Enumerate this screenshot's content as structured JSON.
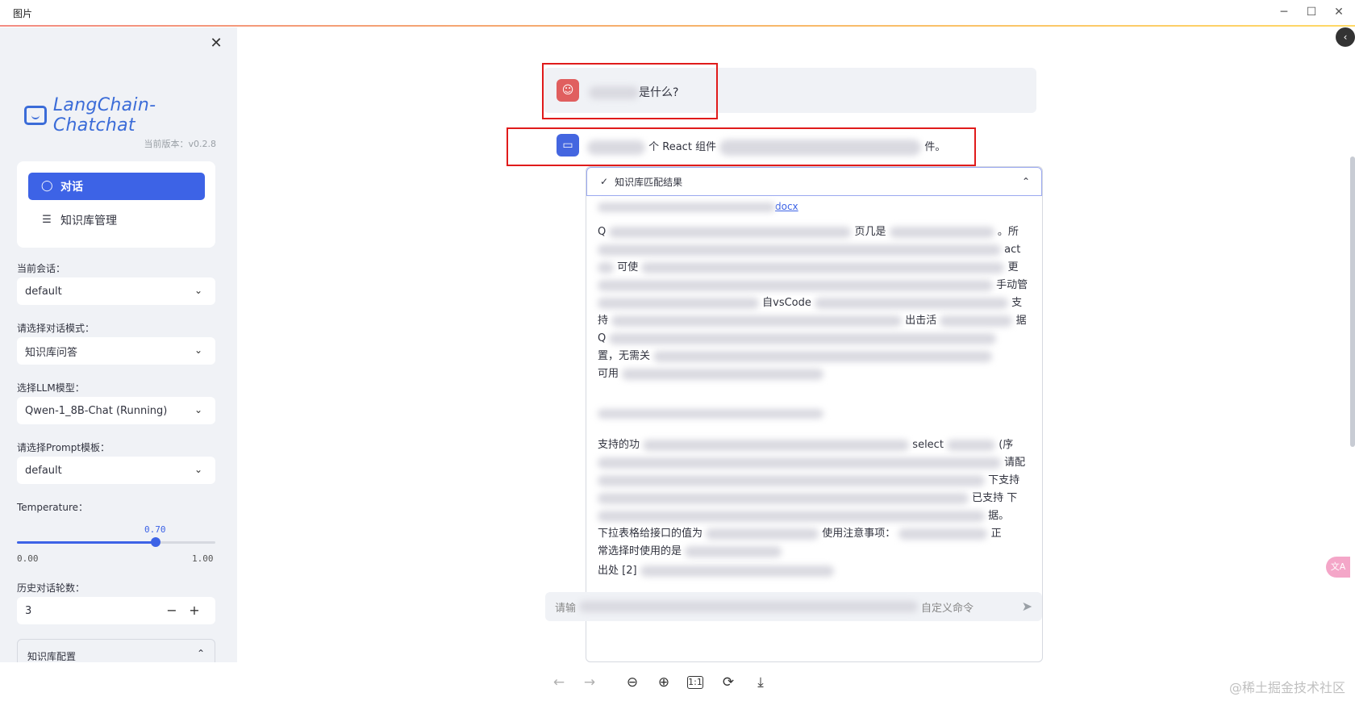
{
  "window": {
    "title": "图片",
    "minimize_icon": "minimize-icon",
    "maximize_icon": "maximize-icon",
    "close_icon": "close-icon"
  },
  "sidebar": {
    "close_glyph": "✕",
    "logo_text": "LangChain-Chatchat",
    "version": "当前版本：v0.2.8",
    "nav": [
      {
        "label": "对话",
        "icon": "chat-bubble-icon",
        "active": true
      },
      {
        "label": "知识库管理",
        "icon": "database-icon",
        "active": false
      }
    ],
    "session_label": "当前会话：",
    "session_value": "default",
    "mode_label": "请选择对话模式：",
    "mode_value": "知识库问答",
    "llm_label": "选择LLM模型：",
    "llm_value": "Qwen-1_8B-Chat (Running)",
    "prompt_label": "请选择Prompt模板：",
    "prompt_value": "default",
    "temperature_label": "Temperature：",
    "temperature_value": "0.70",
    "temperature_fraction": 0.7,
    "temperature_min": "0.00",
    "temperature_max": "1.00",
    "history_label": "历史对话轮数：",
    "history_value": "3",
    "kb_config_label": "知识库配置",
    "accent_color": "#3d63e6"
  },
  "chat": {
    "user_message_suffix": "是什么?",
    "bot_message_fragment_1": "个 React 组件",
    "bot_message_fragment_2": "件。",
    "expander_title": "知识库匹配结果",
    "doc_link_suffix": "docx",
    "para1_fragments": [
      "Q",
      "页几是",
      "。所",
      "act",
      "可使",
      "更",
      "手动管",
      "自vsCode",
      "支",
      "持",
      "出击活",
      "据",
      "Q",
      "置，无需关",
      "可用"
    ],
    "para2_fragments": [
      "支持的功",
      "select",
      "(序",
      "请配",
      "下支持",
      "已支持 下",
      "据。",
      "下拉表格给接口的值为",
      "使用注意事项：",
      "正",
      "常选择时使用的是"
    ],
    "footer_fragment": "出处 [2]",
    "input_placeholder_prefix": "请输",
    "input_placeholder_suffix": "自定义命令",
    "user_avatar_color": "#e05f5f",
    "bot_avatar_color": "#4466e0"
  },
  "toolbar": {
    "icons": [
      "arrow-left-icon",
      "arrow-right-icon",
      "zoom-out-icon",
      "zoom-in-icon",
      "actual-size-icon",
      "rotate-icon",
      "download-icon"
    ],
    "actual_size_label": "1:1",
    "watermark": "@稀土掘金技术社区"
  }
}
